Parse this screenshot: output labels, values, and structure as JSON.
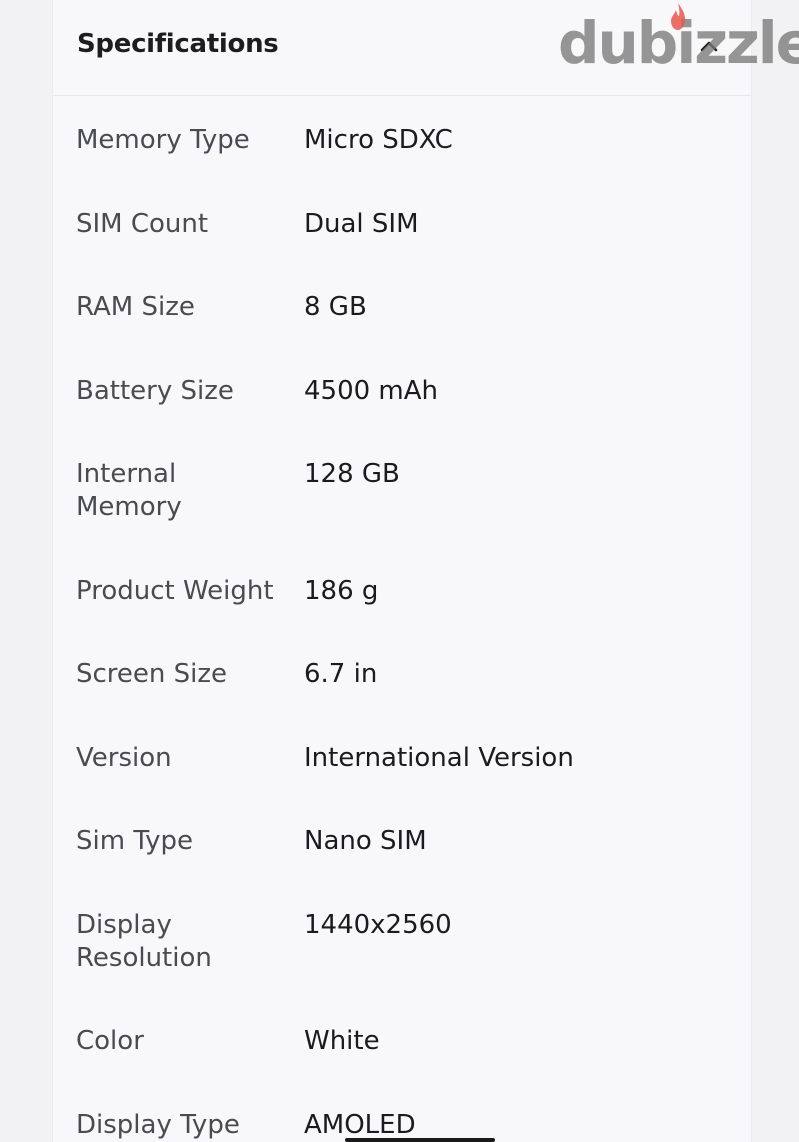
{
  "header": {
    "title": "Specifications",
    "collapse_icon": "chevron-up-icon"
  },
  "watermark": {
    "text": "dubizzle",
    "icon": "flame-icon",
    "flame_color": "#e8574c",
    "text_color": "#787878"
  },
  "specs": [
    {
      "label": "Memory Type",
      "value": "Micro SDXC"
    },
    {
      "label": "SIM Count",
      "value": "Dual SIM"
    },
    {
      "label": "RAM Size",
      "value": "8 GB"
    },
    {
      "label": "Battery Size",
      "value": "4500 mAh"
    },
    {
      "label": "Internal Memory",
      "value": "128 GB"
    },
    {
      "label": "Product Weight",
      "value": "186 g"
    },
    {
      "label": "Screen Size",
      "value": "6.7 in"
    },
    {
      "label": "Version",
      "value": "International Version"
    },
    {
      "label": "Sim Type",
      "value": "Nano SIM"
    },
    {
      "label": "Display Resolution",
      "value": "1440x2560"
    },
    {
      "label": "Color",
      "value": "White"
    },
    {
      "label": "Display Type",
      "value": "AMOLED"
    }
  ]
}
